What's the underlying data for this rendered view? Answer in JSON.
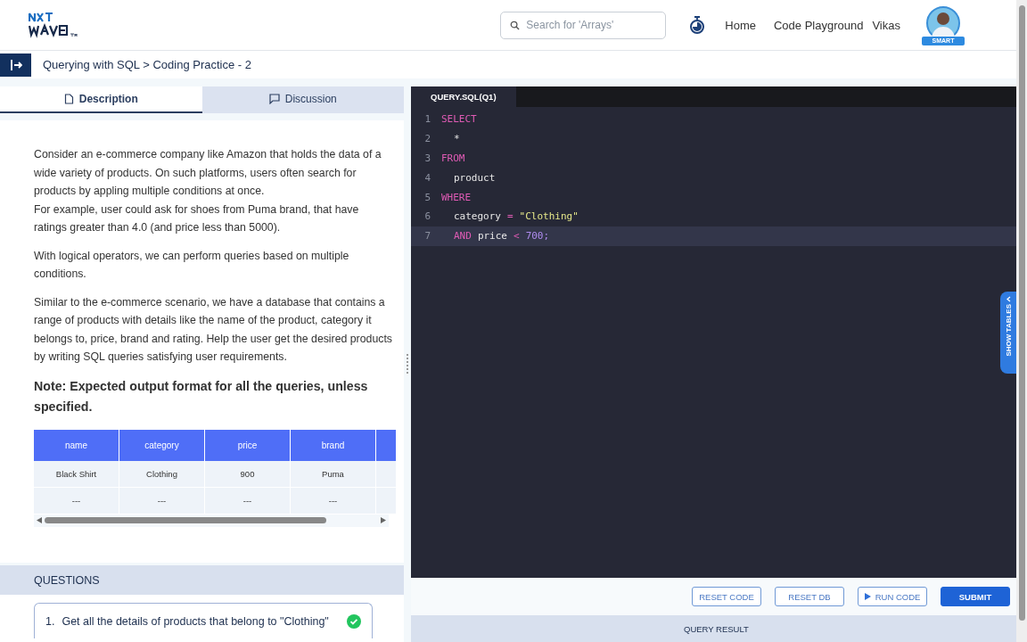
{
  "header": {
    "search": {
      "placeholder": "Search for 'Arrays'"
    },
    "nav": [
      "Home",
      "Code Playground"
    ],
    "user": {
      "name": "Vikas",
      "badge": "SMART"
    }
  },
  "breadcrumb": "Querying with SQL > Coding Practice - 2",
  "tabs": [
    {
      "label": "Description",
      "selected": true
    },
    {
      "label": "Discussion",
      "selected": false
    }
  ],
  "description": {
    "paragraphs": [
      [
        "Consider an e-commerce company like Amazon that holds the data of a wide variety of products. On such platforms, users often search for products by appling multiple conditions at once.",
        "For example, user could ask for shoes from Puma brand, that have ratings greater than 4.0 (and price less than 5000)."
      ],
      [
        "With logical operators, we can perform queries based on multiple conditions."
      ],
      [
        "Similar to the e-commerce scenario, we have a database that contains a range of products with details like the name of the product, category it belongs to, price, brand and rating. Help the user get the desired products by writing SQL queries satisfying user requirements."
      ]
    ],
    "note": "Note: Expected output format for all the queries, unless specified.",
    "table": {
      "columns": [
        "name",
        "category",
        "price",
        "brand"
      ],
      "rows": [
        [
          "Black Shirt",
          "Clothing",
          "900",
          "Puma"
        ],
        [
          "---",
          "---",
          "---",
          "---"
        ]
      ]
    }
  },
  "questions": {
    "title": "QUESTIONS",
    "items": [
      {
        "number": "1.",
        "text": "Get all the details of products that belong to \"Clothing\"",
        "solved": true
      }
    ]
  },
  "editor": {
    "file_tab": "QUERY.SQL(Q1)",
    "lines": [
      {
        "number": "1",
        "indent": false,
        "current": false,
        "tokens": [
          {
            "kind": "keyword",
            "text": "SELECT"
          }
        ]
      },
      {
        "number": "2",
        "indent": true,
        "current": false,
        "tokens": [
          {
            "kind": "plain",
            "text": "*"
          }
        ]
      },
      {
        "number": "3",
        "indent": false,
        "current": false,
        "tokens": [
          {
            "kind": "keyword",
            "text": "FROM"
          }
        ]
      },
      {
        "number": "4",
        "indent": true,
        "current": false,
        "tokens": [
          {
            "kind": "plain",
            "text": "product"
          }
        ]
      },
      {
        "number": "5",
        "indent": false,
        "current": false,
        "tokens": [
          {
            "kind": "keyword",
            "text": "WHERE"
          }
        ]
      },
      {
        "number": "6",
        "indent": true,
        "current": false,
        "tokens": [
          {
            "kind": "plain",
            "text": "category"
          },
          {
            "kind": "operator",
            "text": "="
          },
          {
            "kind": "string",
            "text": "\"Clothing\""
          }
        ]
      },
      {
        "number": "7",
        "indent": true,
        "current": true,
        "tokens": [
          {
            "kind": "keyword",
            "text": "AND"
          },
          {
            "kind": "plain",
            "text": "price"
          },
          {
            "kind": "operator",
            "text": "<"
          },
          {
            "kind": "number",
            "text": "700;"
          }
        ]
      }
    ],
    "side_tab": "SHOW TABLES"
  },
  "actions": [
    {
      "label": "RESET CODE",
      "kind": "outline"
    },
    {
      "label": "RESET DB",
      "kind": "outline"
    },
    {
      "label": "RUN CODE",
      "kind": "run"
    },
    {
      "label": "SUBMIT",
      "kind": "primary"
    }
  ],
  "result_bar": "QUERY RESULT"
}
